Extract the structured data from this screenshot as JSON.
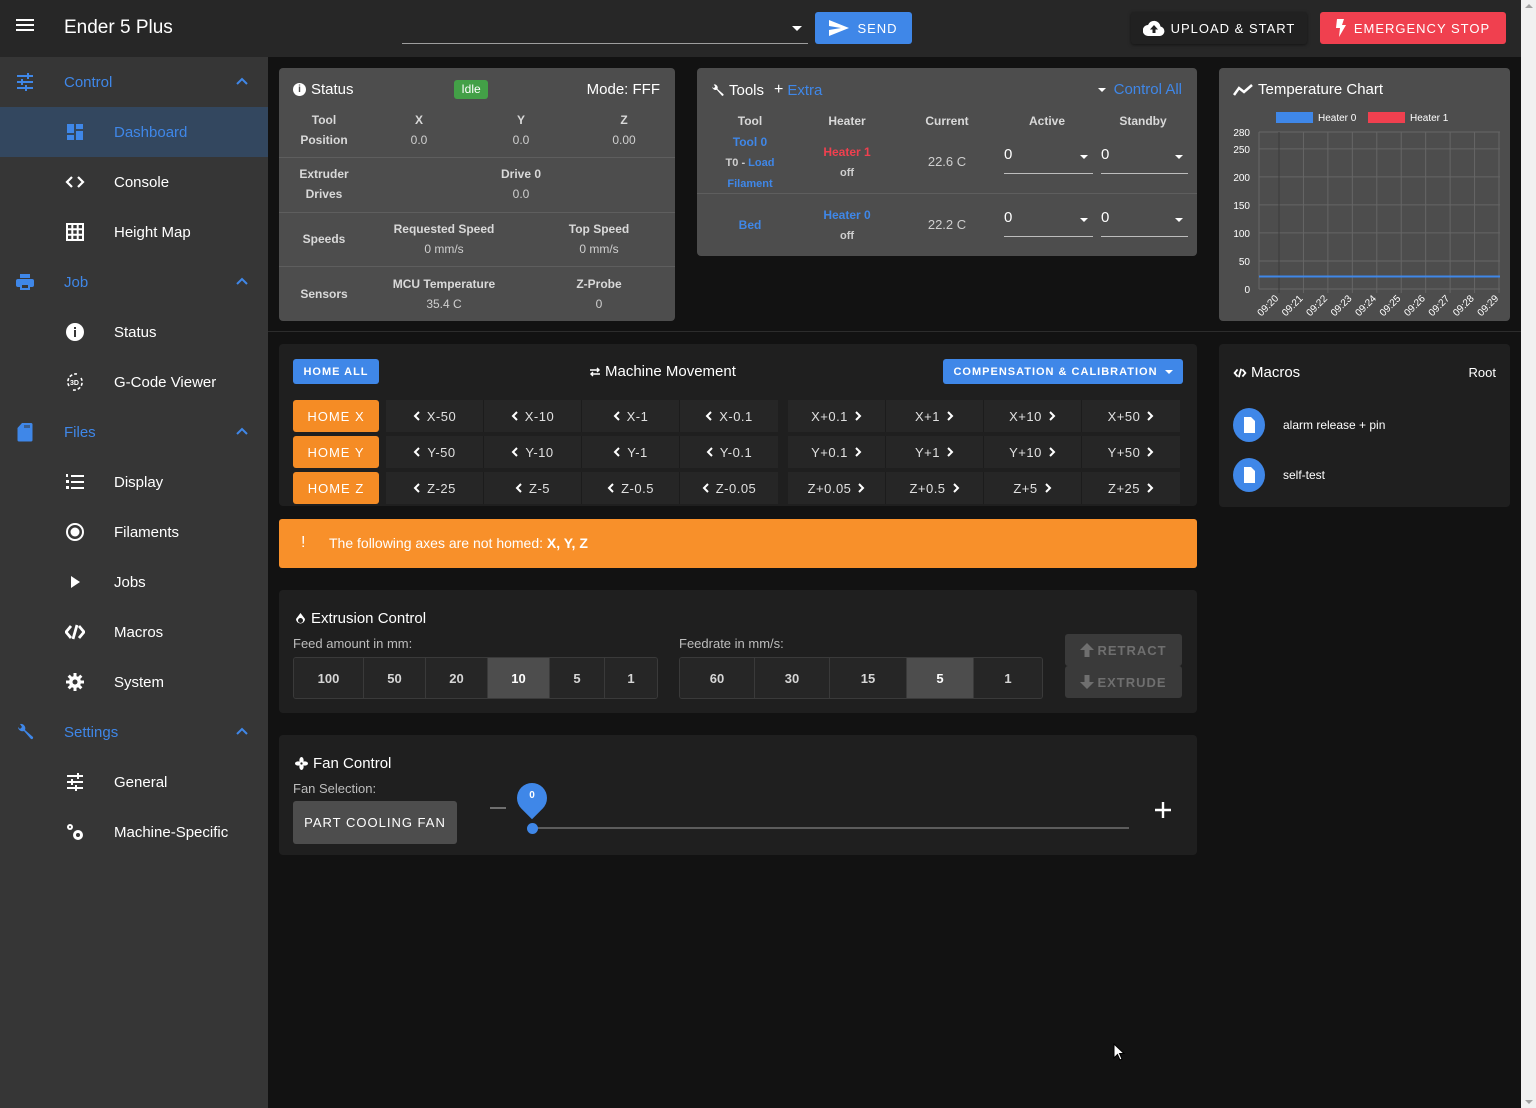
{
  "app": {
    "title": "Ender 5 Plus",
    "code_input": {
      "value": "",
      "placeholder": ""
    },
    "send_label": "Send",
    "upload_label": "Upload & Start",
    "estop_label": "Emergency Stop"
  },
  "sidebar": {
    "groups": [
      {
        "label": "Control",
        "icon": "tune-icon",
        "items": [
          {
            "label": "Dashboard",
            "icon": "dashboard-icon",
            "active": true
          },
          {
            "label": "Console",
            "icon": "code-icon"
          },
          {
            "label": "Height Map",
            "icon": "grid-icon"
          }
        ]
      },
      {
        "label": "Job",
        "icon": "printer-icon",
        "items": [
          {
            "label": "Status",
            "icon": "info-icon"
          },
          {
            "label": "G-Code Viewer",
            "icon": "3d-rotation-icon"
          }
        ]
      },
      {
        "label": "Files",
        "icon": "sd-card-icon",
        "items": [
          {
            "label": "Display",
            "icon": "list-numbered-icon"
          },
          {
            "label": "Filaments",
            "icon": "radio-button-icon"
          },
          {
            "label": "Jobs",
            "icon": "play-icon"
          },
          {
            "label": "Macros",
            "icon": "code-braces-icon"
          },
          {
            "label": "System",
            "icon": "gear-icon"
          }
        ]
      },
      {
        "label": "Settings",
        "icon": "wrench-icon",
        "items": [
          {
            "label": "General",
            "icon": "tune-icon"
          },
          {
            "label": "Machine-Specific",
            "icon": "gears-icon"
          }
        ]
      }
    ]
  },
  "status": {
    "title": "Status",
    "state_badge": "Idle",
    "mode": "Mode: FFF",
    "tool_position": {
      "label1": "Tool",
      "label2": "Position",
      "x_label": "X",
      "x": "0.0",
      "y_label": "Y",
      "y": "0.0",
      "z_label": "Z",
      "z": "0.00"
    },
    "extruder": {
      "label1": "Extruder",
      "label2": "Drives",
      "drive_label": "Drive 0",
      "drive_value": "0.0"
    },
    "speeds": {
      "label": "Speeds",
      "requested_label": "Requested Speed",
      "requested": "0 mm/s",
      "top_label": "Top Speed",
      "top": "0 mm/s"
    },
    "sensors": {
      "label": "Sensors",
      "mcu_label": "MCU Temperature",
      "mcu": "35.4 C",
      "zprobe_label": "Z-Probe",
      "zprobe": "0"
    }
  },
  "tools": {
    "title": "Tools",
    "extra_label": "Extra",
    "control_all_label": "Control All",
    "headers": [
      "Tool",
      "Heater",
      "Current",
      "Active",
      "Standby"
    ],
    "rows": [
      {
        "tool": "Tool 0",
        "tool_sub_prefix": "T0 - ",
        "tool_sub_link1": "Load",
        "tool_sub_link2": "Filament",
        "heater": "Heater 1",
        "heater_state": "off",
        "current": "22.6 C",
        "active": "0",
        "standby": "0"
      },
      {
        "tool": "Bed",
        "heater": "Heater 0",
        "heater_state": "off",
        "current": "22.2 C",
        "active": "0",
        "standby": "0"
      }
    ]
  },
  "chart_data": {
    "type": "line",
    "title": "Temperature Chart",
    "series": [
      {
        "name": "Heater 0",
        "color": "#3f87e8",
        "values": [
          22.2,
          22.2,
          22.2,
          22.2,
          22.2,
          22.2,
          22.2,
          22.2,
          22.2,
          22.2,
          22.2
        ]
      },
      {
        "name": "Heater 1",
        "color": "#f0404f",
        "values": []
      }
    ],
    "x": [
      "09:20",
      "09:21",
      "09:22",
      "09:23",
      "09:24",
      "09:25",
      "09:26",
      "09:27",
      "09:28",
      "09:29"
    ],
    "y_ticks": [
      0,
      50,
      100,
      150,
      200,
      250,
      280
    ],
    "ylim": [
      0,
      280
    ],
    "xlabel": "",
    "ylabel": "",
    "grid": true,
    "legend": "top-center"
  },
  "movement": {
    "title": "Machine Movement",
    "home_all": "Home All",
    "compensation": "Compensation & Calibration",
    "axes": [
      {
        "home": "Home X",
        "minus": [
          "X-50",
          "X-10",
          "X-1",
          "X-0.1"
        ],
        "plus": [
          "X+0.1",
          "X+1",
          "X+10",
          "X+50"
        ]
      },
      {
        "home": "Home Y",
        "minus": [
          "Y-50",
          "Y-10",
          "Y-1",
          "Y-0.1"
        ],
        "plus": [
          "Y+0.1",
          "Y+1",
          "Y+10",
          "Y+50"
        ]
      },
      {
        "home": "Home Z",
        "minus": [
          "Z-25",
          "Z-5",
          "Z-0.5",
          "Z-0.05"
        ],
        "plus": [
          "Z+0.05",
          "Z+0.5",
          "Z+5",
          "Z+25"
        ]
      }
    ]
  },
  "alert": {
    "icon": "!",
    "message": "The following axes are not homed: ",
    "axes": "X, Y, Z"
  },
  "macros": {
    "title": "Macros",
    "root_label": "Root",
    "items": [
      "alarm release + pin",
      "self-test"
    ]
  },
  "extrusion": {
    "title": "Extrusion Control",
    "feed_label": "Feed amount in mm:",
    "feed_options": [
      "100",
      "50",
      "20",
      "10",
      "5",
      "1"
    ],
    "feed_selected": "10",
    "rate_label": "Feedrate in mm/s:",
    "rate_options": [
      "60",
      "30",
      "15",
      "5",
      "1"
    ],
    "rate_selected": "5",
    "retract_label": "Retract",
    "extrude_label": "Extrude"
  },
  "fan": {
    "title": "Fan Control",
    "selection_label": "Fan Selection:",
    "selected_fan": "Part Cooling Fan",
    "value": "0",
    "value_percent": 0
  }
}
